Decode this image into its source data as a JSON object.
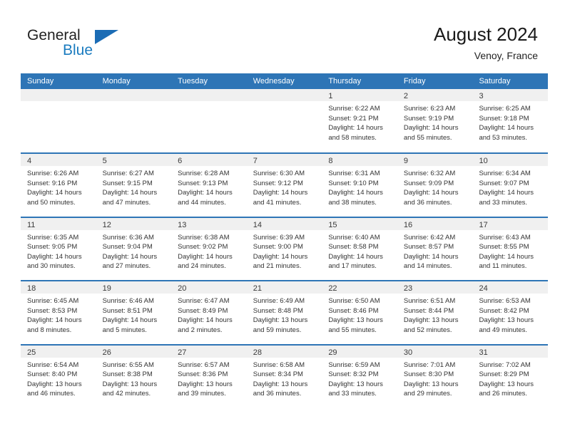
{
  "brand": {
    "name_part1": "General",
    "name_part2": "Blue",
    "accent_color": "#1b6cb5"
  },
  "header": {
    "title": "August 2024",
    "subtitle": "Venoy, France",
    "header_bg_color": "#2e75b6",
    "daynum_band_color": "#f0f0f0"
  },
  "weekdays": [
    "Sunday",
    "Monday",
    "Tuesday",
    "Wednesday",
    "Thursday",
    "Friday",
    "Saturday"
  ],
  "weeks": [
    [
      {
        "day": "",
        "sunrise": "",
        "sunset": "",
        "daylight_line1": "",
        "daylight_line2": ""
      },
      {
        "day": "",
        "sunrise": "",
        "sunset": "",
        "daylight_line1": "",
        "daylight_line2": ""
      },
      {
        "day": "",
        "sunrise": "",
        "sunset": "",
        "daylight_line1": "",
        "daylight_line2": ""
      },
      {
        "day": "",
        "sunrise": "",
        "sunset": "",
        "daylight_line1": "",
        "daylight_line2": ""
      },
      {
        "day": "1",
        "sunrise": "Sunrise: 6:22 AM",
        "sunset": "Sunset: 9:21 PM",
        "daylight_line1": "Daylight: 14 hours",
        "daylight_line2": "and 58 minutes."
      },
      {
        "day": "2",
        "sunrise": "Sunrise: 6:23 AM",
        "sunset": "Sunset: 9:19 PM",
        "daylight_line1": "Daylight: 14 hours",
        "daylight_line2": "and 55 minutes."
      },
      {
        "day": "3",
        "sunrise": "Sunrise: 6:25 AM",
        "sunset": "Sunset: 9:18 PM",
        "daylight_line1": "Daylight: 14 hours",
        "daylight_line2": "and 53 minutes."
      }
    ],
    [
      {
        "day": "4",
        "sunrise": "Sunrise: 6:26 AM",
        "sunset": "Sunset: 9:16 PM",
        "daylight_line1": "Daylight: 14 hours",
        "daylight_line2": "and 50 minutes."
      },
      {
        "day": "5",
        "sunrise": "Sunrise: 6:27 AM",
        "sunset": "Sunset: 9:15 PM",
        "daylight_line1": "Daylight: 14 hours",
        "daylight_line2": "and 47 minutes."
      },
      {
        "day": "6",
        "sunrise": "Sunrise: 6:28 AM",
        "sunset": "Sunset: 9:13 PM",
        "daylight_line1": "Daylight: 14 hours",
        "daylight_line2": "and 44 minutes."
      },
      {
        "day": "7",
        "sunrise": "Sunrise: 6:30 AM",
        "sunset": "Sunset: 9:12 PM",
        "daylight_line1": "Daylight: 14 hours",
        "daylight_line2": "and 41 minutes."
      },
      {
        "day": "8",
        "sunrise": "Sunrise: 6:31 AM",
        "sunset": "Sunset: 9:10 PM",
        "daylight_line1": "Daylight: 14 hours",
        "daylight_line2": "and 38 minutes."
      },
      {
        "day": "9",
        "sunrise": "Sunrise: 6:32 AM",
        "sunset": "Sunset: 9:09 PM",
        "daylight_line1": "Daylight: 14 hours",
        "daylight_line2": "and 36 minutes."
      },
      {
        "day": "10",
        "sunrise": "Sunrise: 6:34 AM",
        "sunset": "Sunset: 9:07 PM",
        "daylight_line1": "Daylight: 14 hours",
        "daylight_line2": "and 33 minutes."
      }
    ],
    [
      {
        "day": "11",
        "sunrise": "Sunrise: 6:35 AM",
        "sunset": "Sunset: 9:05 PM",
        "daylight_line1": "Daylight: 14 hours",
        "daylight_line2": "and 30 minutes."
      },
      {
        "day": "12",
        "sunrise": "Sunrise: 6:36 AM",
        "sunset": "Sunset: 9:04 PM",
        "daylight_line1": "Daylight: 14 hours",
        "daylight_line2": "and 27 minutes."
      },
      {
        "day": "13",
        "sunrise": "Sunrise: 6:38 AM",
        "sunset": "Sunset: 9:02 PM",
        "daylight_line1": "Daylight: 14 hours",
        "daylight_line2": "and 24 minutes."
      },
      {
        "day": "14",
        "sunrise": "Sunrise: 6:39 AM",
        "sunset": "Sunset: 9:00 PM",
        "daylight_line1": "Daylight: 14 hours",
        "daylight_line2": "and 21 minutes."
      },
      {
        "day": "15",
        "sunrise": "Sunrise: 6:40 AM",
        "sunset": "Sunset: 8:58 PM",
        "daylight_line1": "Daylight: 14 hours",
        "daylight_line2": "and 17 minutes."
      },
      {
        "day": "16",
        "sunrise": "Sunrise: 6:42 AM",
        "sunset": "Sunset: 8:57 PM",
        "daylight_line1": "Daylight: 14 hours",
        "daylight_line2": "and 14 minutes."
      },
      {
        "day": "17",
        "sunrise": "Sunrise: 6:43 AM",
        "sunset": "Sunset: 8:55 PM",
        "daylight_line1": "Daylight: 14 hours",
        "daylight_line2": "and 11 minutes."
      }
    ],
    [
      {
        "day": "18",
        "sunrise": "Sunrise: 6:45 AM",
        "sunset": "Sunset: 8:53 PM",
        "daylight_line1": "Daylight: 14 hours",
        "daylight_line2": "and 8 minutes."
      },
      {
        "day": "19",
        "sunrise": "Sunrise: 6:46 AM",
        "sunset": "Sunset: 8:51 PM",
        "daylight_line1": "Daylight: 14 hours",
        "daylight_line2": "and 5 minutes."
      },
      {
        "day": "20",
        "sunrise": "Sunrise: 6:47 AM",
        "sunset": "Sunset: 8:49 PM",
        "daylight_line1": "Daylight: 14 hours",
        "daylight_line2": "and 2 minutes."
      },
      {
        "day": "21",
        "sunrise": "Sunrise: 6:49 AM",
        "sunset": "Sunset: 8:48 PM",
        "daylight_line1": "Daylight: 13 hours",
        "daylight_line2": "and 59 minutes."
      },
      {
        "day": "22",
        "sunrise": "Sunrise: 6:50 AM",
        "sunset": "Sunset: 8:46 PM",
        "daylight_line1": "Daylight: 13 hours",
        "daylight_line2": "and 55 minutes."
      },
      {
        "day": "23",
        "sunrise": "Sunrise: 6:51 AM",
        "sunset": "Sunset: 8:44 PM",
        "daylight_line1": "Daylight: 13 hours",
        "daylight_line2": "and 52 minutes."
      },
      {
        "day": "24",
        "sunrise": "Sunrise: 6:53 AM",
        "sunset": "Sunset: 8:42 PM",
        "daylight_line1": "Daylight: 13 hours",
        "daylight_line2": "and 49 minutes."
      }
    ],
    [
      {
        "day": "25",
        "sunrise": "Sunrise: 6:54 AM",
        "sunset": "Sunset: 8:40 PM",
        "daylight_line1": "Daylight: 13 hours",
        "daylight_line2": "and 46 minutes."
      },
      {
        "day": "26",
        "sunrise": "Sunrise: 6:55 AM",
        "sunset": "Sunset: 8:38 PM",
        "daylight_line1": "Daylight: 13 hours",
        "daylight_line2": "and 42 minutes."
      },
      {
        "day": "27",
        "sunrise": "Sunrise: 6:57 AM",
        "sunset": "Sunset: 8:36 PM",
        "daylight_line1": "Daylight: 13 hours",
        "daylight_line2": "and 39 minutes."
      },
      {
        "day": "28",
        "sunrise": "Sunrise: 6:58 AM",
        "sunset": "Sunset: 8:34 PM",
        "daylight_line1": "Daylight: 13 hours",
        "daylight_line2": "and 36 minutes."
      },
      {
        "day": "29",
        "sunrise": "Sunrise: 6:59 AM",
        "sunset": "Sunset: 8:32 PM",
        "daylight_line1": "Daylight: 13 hours",
        "daylight_line2": "and 33 minutes."
      },
      {
        "day": "30",
        "sunrise": "Sunrise: 7:01 AM",
        "sunset": "Sunset: 8:30 PM",
        "daylight_line1": "Daylight: 13 hours",
        "daylight_line2": "and 29 minutes."
      },
      {
        "day": "31",
        "sunrise": "Sunrise: 7:02 AM",
        "sunset": "Sunset: 8:29 PM",
        "daylight_line1": "Daylight: 13 hours",
        "daylight_line2": "and 26 minutes."
      }
    ]
  ]
}
